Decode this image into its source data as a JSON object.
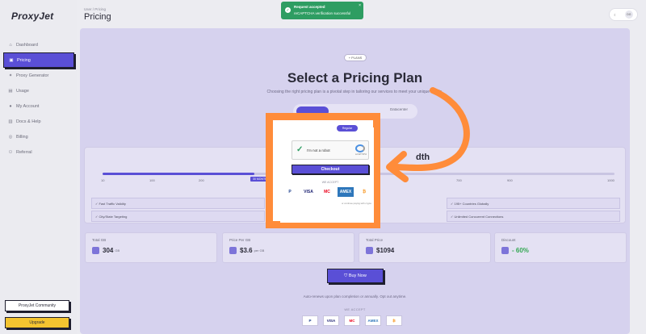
{
  "brand": {
    "logo": "ProxyJet"
  },
  "sidebar": {
    "items": [
      {
        "label": "Dashboard",
        "icon": "home-icon"
      },
      {
        "label": "Pricing",
        "icon": "tag-icon",
        "active": true
      },
      {
        "label": "Proxy Generator",
        "icon": "wand-icon"
      },
      {
        "label": "Usage",
        "icon": "chart-icon"
      },
      {
        "label": "My Account",
        "icon": "user-icon"
      },
      {
        "label": "Docs & Help",
        "icon": "book-icon"
      },
      {
        "label": "Billing",
        "icon": "card-icon"
      },
      {
        "label": "Referral",
        "icon": "people-icon"
      }
    ],
    "community": "ProxyJet Community",
    "upgrade": "Upgrade"
  },
  "header": {
    "breadcrumb": "User / Pricing",
    "title": "Pricing",
    "user_initials": "DG"
  },
  "toast": {
    "title": "Request accepted",
    "message": "reCAPTCHA verification successful"
  },
  "pricing": {
    "badge": "+ PLANS",
    "headline": "Select a Pricing Plan",
    "subtitle": "Choosing the right pricing plan is a pivotal step in tailoring our services to meet your unique needs.",
    "toggle_3": "Datacenter",
    "bandwidth_title": "dth",
    "slider_ticks": [
      "10",
      "100",
      "200",
      "700",
      "900",
      "1000"
    ],
    "slider_label": "30 MONTH",
    "features": [
      "Fast Traffic Validity",
      "City/State Targeting",
      "195+ Countries Globally",
      "Unlimited Concurrent Connections"
    ],
    "stats": [
      {
        "label": "Total GB",
        "value": "304",
        "unit": "GB"
      },
      {
        "label": "Price Per GB",
        "value": "$3.6",
        "unit": "per GB"
      },
      {
        "label": "Total Price",
        "value": "$1094",
        "unit": ""
      },
      {
        "label": "Discount",
        "value": "- 60%",
        "unit": ""
      }
    ],
    "buy_button": "Buy Now",
    "renew_note": "Auto-renews upon plan completion or annually. Opt out anytime.",
    "we_accept": "WE ACCEPT",
    "payments": [
      "P",
      "VISA",
      "MC",
      "AMEX",
      "₿"
    ]
  },
  "checkout": {
    "tab_active": "Regular",
    "captcha_label": "I'm not a robot",
    "captcha_brand": "reCAPTCHA",
    "checkout_button": "Checkout",
    "we_accept": "WE ACCEPT",
    "payments": [
      "P",
      "VISA",
      "MC",
      "AMEX",
      "₿"
    ],
    "crypto_note": "or continue paying with crypto"
  },
  "colors": {
    "accent": "#5a4fd6",
    "highlight": "#ff8c3a",
    "success": "#2e9d62",
    "upgrade": "#f4c430"
  }
}
